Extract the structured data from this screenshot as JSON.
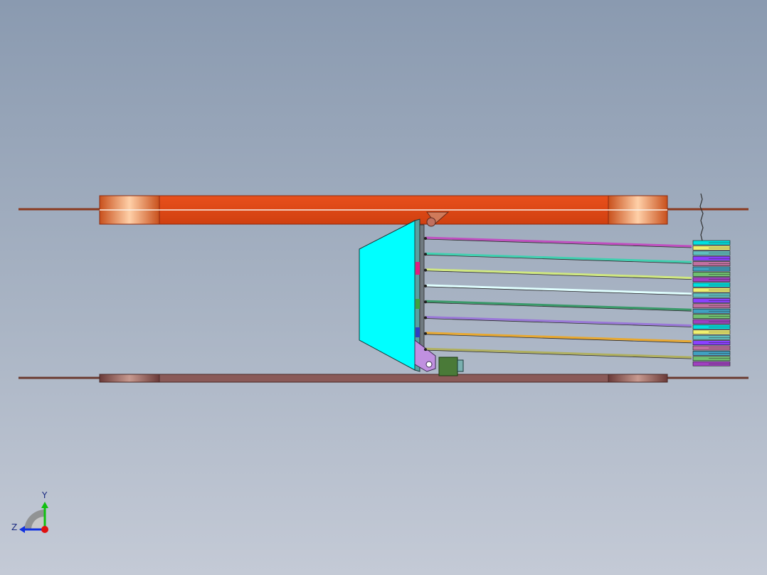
{
  "viewport": {
    "background_top": "#8a9ab0",
    "background_bottom": "#c4cad6"
  },
  "model": {
    "upper_frame_color": "#e8501c",
    "upper_frame_highlight": "#ffb07a",
    "lower_frame_color": "#7a4a48",
    "rail_color": "#8a3a20",
    "panel_color": "#00ffff",
    "bracket_color": "#b07ad0",
    "roller_color": "#4a7a38",
    "bar_colors": [
      "#c050c0",
      "#40d0b0",
      "#d0e880",
      "#e0ffff",
      "#3a9a6a",
      "#9a78d8",
      "#e8a830",
      "#b0b060"
    ],
    "stack_colors": [
      "#00e0e0",
      "#f0f070",
      "#60c0c0",
      "#8a40ff",
      "#c070a0",
      "#40a0c0",
      "#70c070",
      "#a040c0"
    ]
  },
  "triad": {
    "x_color": "#e01010",
    "y_color": "#10c010",
    "z_color": "#1030e0",
    "y_label": "Y",
    "z_label": "Z"
  }
}
